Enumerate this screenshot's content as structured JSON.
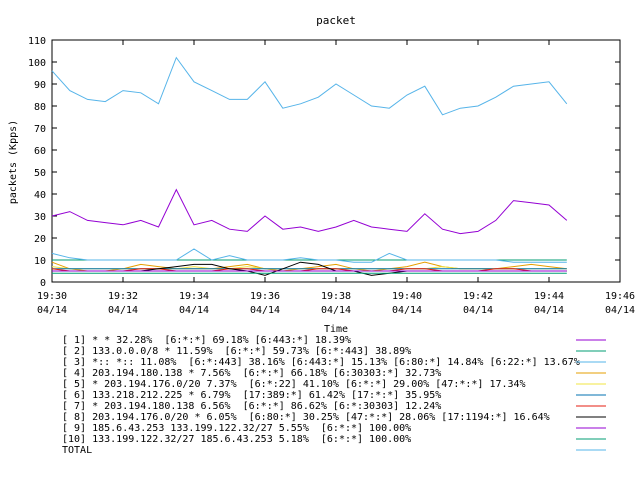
{
  "chart_data": {
    "type": "line",
    "title": "packet",
    "xlabel": "Time",
    "ylabel": "packets (Kpps)",
    "ylim": [
      0,
      110
    ],
    "yticks": [
      0,
      10,
      20,
      30,
      40,
      50,
      60,
      70,
      80,
      90,
      100,
      110
    ],
    "xlim": [
      0,
      76
    ],
    "xticks": [
      {
        "v": 0,
        "time": "19:30",
        "date": "04/14"
      },
      {
        "v": 12,
        "time": "19:32",
        "date": "04/14"
      },
      {
        "v": 24,
        "time": "19:34",
        "date": "04/14"
      },
      {
        "v": 36,
        "time": "19:36",
        "date": "04/14"
      },
      {
        "v": 48,
        "time": "19:38",
        "date": "04/14"
      },
      {
        "v": 60,
        "time": "19:40",
        "date": "04/14"
      },
      {
        "v": 72,
        "time": "19:42",
        "date": "04/14"
      },
      {
        "v": 84,
        "time": "19:44",
        "date": "04/14"
      },
      {
        "v": 96,
        "time": "19:46",
        "date": "04/14"
      }
    ],
    "x": [
      0,
      3,
      6,
      9,
      12,
      15,
      18,
      21,
      24,
      27,
      30,
      33,
      36,
      39,
      42,
      45,
      48,
      51,
      54,
      57,
      60,
      63,
      66,
      69,
      72,
      75,
      78,
      81,
      84,
      87
    ],
    "series": [
      {
        "name": "[ 1] * * 32.28%  [6:*:*] 69.18% [6:443:*] 18.39%",
        "color": "#9400d3",
        "values": [
          30,
          32,
          28,
          27,
          26,
          28,
          25,
          42,
          26,
          28,
          24,
          23,
          30,
          24,
          25,
          23,
          25,
          28,
          25,
          24,
          23,
          31,
          24,
          22,
          23,
          28,
          37,
          36,
          35,
          28
        ]
      },
      {
        "name": "[ 2] 133.0.0.0/8 * 11.59%  [6:*:*] 59.73% [6:*:443] 38.89%",
        "color": "#009e73",
        "values": [
          10,
          10,
          10,
          10,
          10,
          10,
          10,
          10,
          10,
          10,
          10,
          10,
          10,
          10,
          10,
          10,
          10,
          10,
          10,
          10,
          10,
          10,
          10,
          10,
          10,
          10,
          10,
          10,
          10,
          10
        ]
      },
      {
        "name": "[ 3] *:: *:: 11.08%  [6:*:443] 38.16% [6:443:*] 15.13% [6:80:*] 14.84% [6:22:*] 13.67%",
        "color": "#56b4e9",
        "values": [
          13,
          11,
          10,
          10,
          10,
          10,
          10,
          10,
          15,
          10,
          12,
          10,
          10,
          10,
          11,
          10,
          10,
          9,
          9,
          13,
          10,
          10,
          10,
          10,
          10,
          10,
          9,
          9,
          9,
          9
        ]
      },
      {
        "name": "[ 4] 203.194.180.138 * 7.56%  [6:*:*] 66.18% [6:30303:*] 32.73%",
        "color": "#e69f00",
        "values": [
          9,
          6,
          5,
          5,
          6,
          8,
          7,
          6,
          6,
          6,
          7,
          8,
          6,
          5,
          6,
          7,
          8,
          6,
          5,
          6,
          7,
          9,
          7,
          6,
          6,
          6,
          7,
          8,
          7,
          6
        ]
      },
      {
        "name": "[ 5] * 203.194.176.0/20 7.37%  [6:*:22] 41.10% [6:*:*] 29.00% [47:*:*] 17.34%",
        "color": "#f0e442",
        "values": [
          7,
          6,
          6,
          6,
          6,
          6,
          6,
          6,
          7,
          6,
          6,
          7,
          6,
          6,
          6,
          6,
          6,
          6,
          6,
          6,
          6,
          6,
          7,
          6,
          6,
          6,
          6,
          6,
          6,
          6
        ]
      },
      {
        "name": "[ 6] 133.218.212.225 * 6.79%  [17:389:*] 61.42% [17:*:*] 35.95%",
        "color": "#0072b2",
        "values": [
          6,
          6,
          6,
          6,
          6,
          6,
          6,
          6,
          6,
          6,
          6,
          6,
          6,
          6,
          6,
          6,
          6,
          6,
          6,
          6,
          6,
          6,
          6,
          6,
          6,
          6,
          6,
          6,
          6,
          6
        ]
      },
      {
        "name": "[ 7] * 203.194.180.138 6.56%  [6:*:*] 86.62% [6:*:30303] 12.24%",
        "color": "#e51e10",
        "values": [
          6,
          5,
          5,
          5,
          5,
          6,
          6,
          5,
          5,
          5,
          6,
          6,
          5,
          5,
          5,
          6,
          6,
          5,
          5,
          5,
          6,
          6,
          5,
          5,
          5,
          6,
          6,
          5,
          5,
          5
        ]
      },
      {
        "name": "[ 8] 203.194.176.0/20 * 6.05%  [6:80:*] 30.25% [47:*:*] 28.06% [17:1194:*] 16.64%",
        "color": "#000000",
        "values": [
          5,
          5,
          5,
          5,
          5,
          5,
          6,
          7,
          8,
          8,
          6,
          5,
          3,
          6,
          9,
          8,
          5,
          5,
          3,
          4,
          5,
          5,
          5,
          5,
          5,
          5,
          5,
          5,
          5,
          5
        ]
      },
      {
        "name": "[ 9] 185.6.43.253 133.199.122.32/27 5.55%  [6:*:*] 100.00%",
        "color": "#9400d3",
        "values": [
          5,
          5,
          5,
          5,
          5,
          5,
          5,
          5,
          5,
          5,
          5,
          5,
          5,
          5,
          5,
          5,
          5,
          5,
          5,
          5,
          5,
          5,
          5,
          5,
          5,
          5,
          5,
          5,
          5,
          5
        ]
      },
      {
        "name": "[10] 133.199.122.32/27 185.6.43.253 5.18%  [6:*:*] 100.00%",
        "color": "#009e73",
        "values": [
          4,
          4,
          4,
          4,
          4,
          4,
          4,
          4,
          4,
          4,
          4,
          4,
          4,
          4,
          4,
          4,
          4,
          4,
          4,
          4,
          4,
          4,
          4,
          4,
          4,
          4,
          4,
          4,
          4,
          4
        ]
      },
      {
        "name": "TOTAL",
        "color": "#56b4e9",
        "values": [
          96,
          87,
          83,
          82,
          87,
          86,
          81,
          102,
          91,
          87,
          83,
          83,
          91,
          79,
          81,
          84,
          90,
          85,
          80,
          79,
          85,
          89,
          76,
          79,
          80,
          84,
          89,
          90,
          91,
          81
        ]
      }
    ],
    "grid": false,
    "legend_placement": "bottom"
  }
}
